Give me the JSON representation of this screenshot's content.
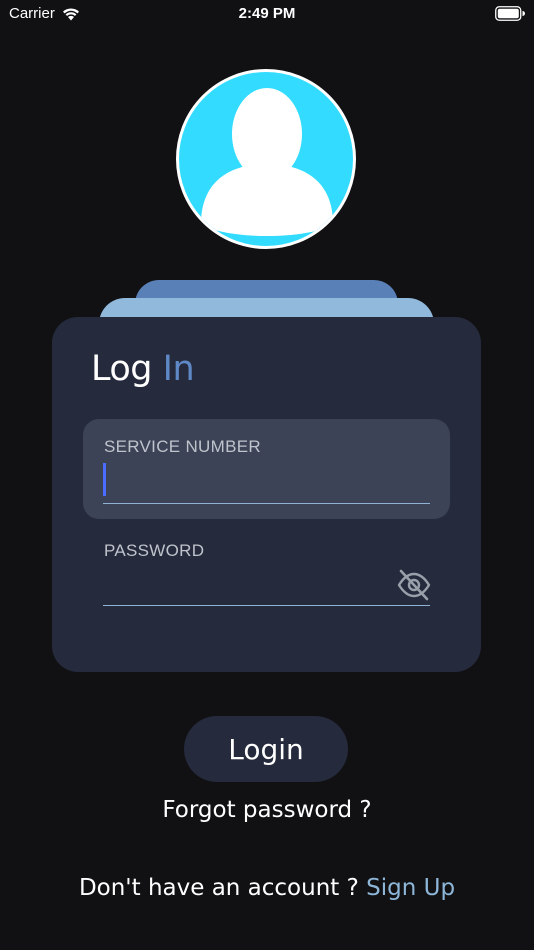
{
  "status_bar": {
    "carrier": "Carrier",
    "time": "2:49 PM"
  },
  "icons": {
    "wifi": "wifi-icon",
    "battery": "battery-icon",
    "avatar": "user-silhouette-icon",
    "password_toggle": "eye-slash-icon"
  },
  "login_card": {
    "title_word1": "Log",
    "title_word2": "In",
    "service_number": {
      "label": "SERVICE NUMBER",
      "value": ""
    },
    "password": {
      "label": "PASSWORD",
      "value": ""
    }
  },
  "login_button_label": "Login",
  "forgot_password_label": "Forgot password ?",
  "signup": {
    "prompt": "Don't have an account ?",
    "link_label": "Sign Up"
  },
  "colors": {
    "background": "#111113",
    "card": "#252b3d",
    "accent": "#5f88c6",
    "link": "#8db6d8",
    "avatar": "#33dcff",
    "cursor": "#4a6cff"
  }
}
